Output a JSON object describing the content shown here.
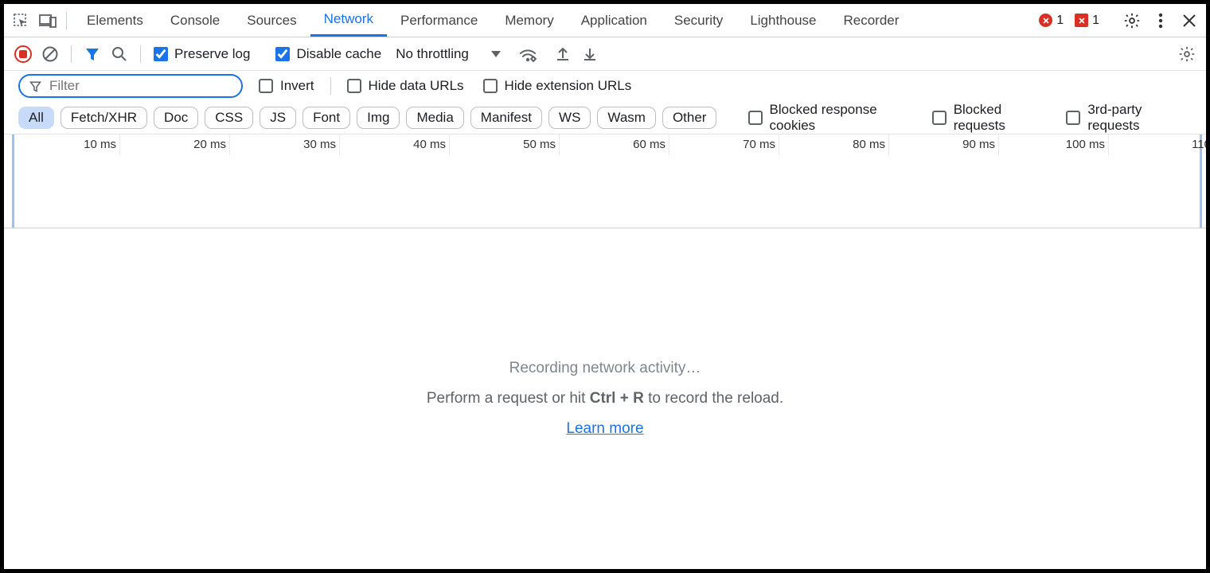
{
  "tabs": [
    "Elements",
    "Console",
    "Sources",
    "Network",
    "Performance",
    "Memory",
    "Application",
    "Security",
    "Lighthouse",
    "Recorder"
  ],
  "active_tab": "Network",
  "errors_count": "1",
  "issues_count": "1",
  "toolbar": {
    "preserve_log": "Preserve log",
    "disable_cache": "Disable cache",
    "throttling": "No throttling"
  },
  "filter": {
    "placeholder": "Filter",
    "invert": "Invert",
    "hide_data": "Hide data URLs",
    "hide_ext": "Hide extension URLs"
  },
  "chips": [
    "All",
    "Fetch/XHR",
    "Doc",
    "CSS",
    "JS",
    "Font",
    "Img",
    "Media",
    "Manifest",
    "WS",
    "Wasm",
    "Other"
  ],
  "active_chip": "All",
  "chip_checks": {
    "blocked_cookies": "Blocked response cookies",
    "blocked_req": "Blocked requests",
    "third_party": "3rd-party requests"
  },
  "timeline_labels": [
    "10 ms",
    "20 ms",
    "30 ms",
    "40 ms",
    "50 ms",
    "60 ms",
    "70 ms",
    "80 ms",
    "90 ms",
    "100 ms",
    "110"
  ],
  "empty": {
    "title": "Recording network activity…",
    "hint_pre": "Perform a request or hit ",
    "hint_key": "Ctrl + R",
    "hint_post": " to record the reload.",
    "learn": "Learn more"
  }
}
